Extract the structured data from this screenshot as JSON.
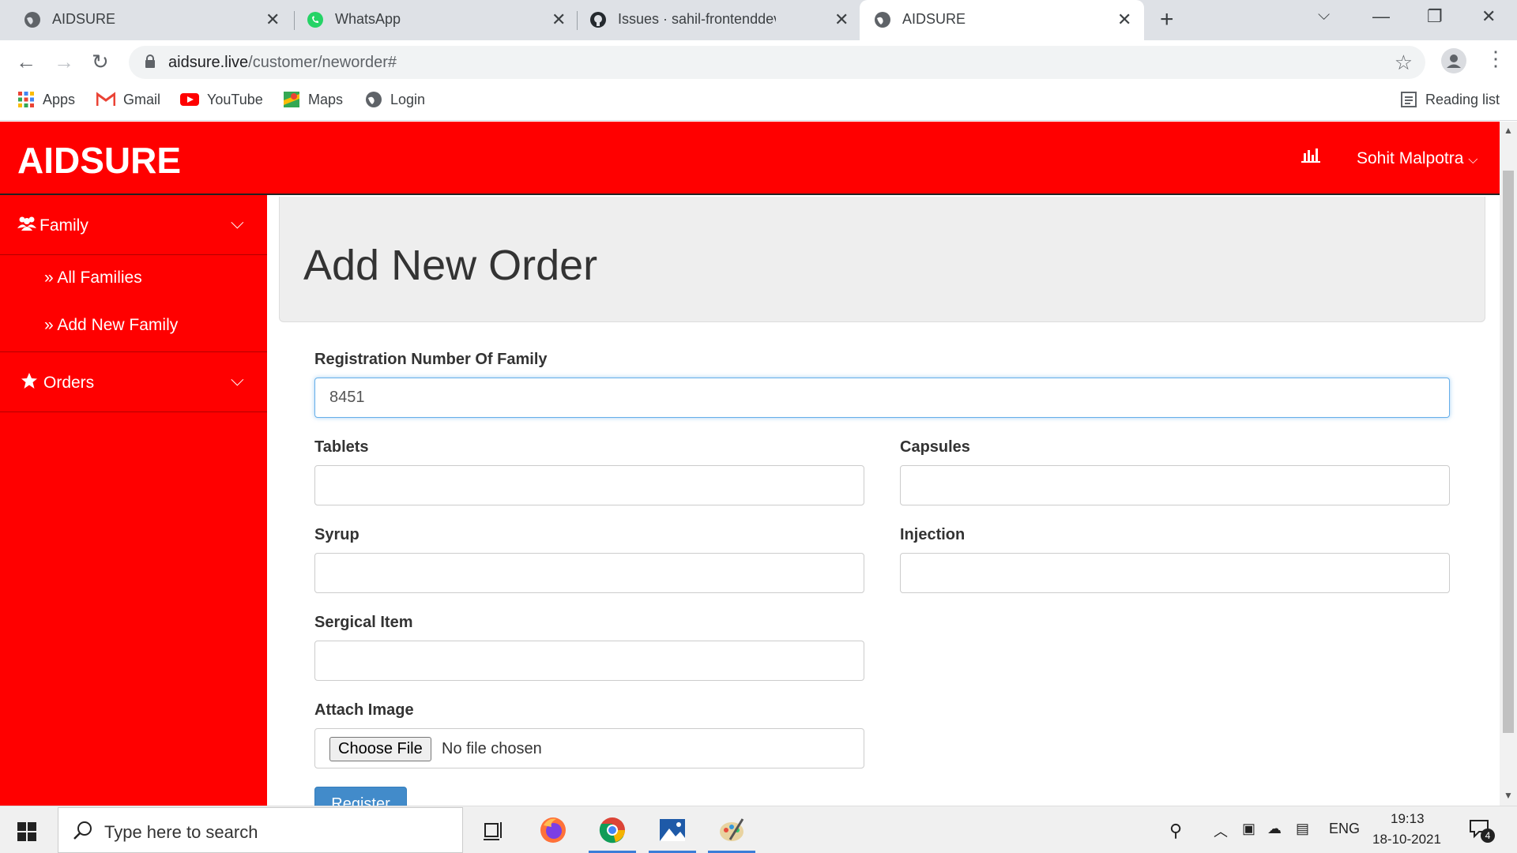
{
  "browser": {
    "tabs": [
      {
        "title": "AIDSURE",
        "icon": "globe-icon",
        "active": false
      },
      {
        "title": "WhatsApp",
        "icon": "whatsapp-icon",
        "active": false
      },
      {
        "title": "Issues · sahil-frontenddev/Aidsur",
        "icon": "github-icon",
        "active": false
      },
      {
        "title": "AIDSURE",
        "icon": "globe-icon",
        "active": true
      }
    ],
    "new_tab_glyph": "+",
    "close_glyph": "✕",
    "url_host": "aidsure.live",
    "url_path": "/customer/neworder#",
    "bookmarks": [
      {
        "label": "Apps",
        "icon": "apps-grid-icon"
      },
      {
        "label": "Gmail",
        "icon": "gmail-icon"
      },
      {
        "label": "YouTube",
        "icon": "youtube-icon"
      },
      {
        "label": "Maps",
        "icon": "maps-icon"
      },
      {
        "label": "Login",
        "icon": "globe-icon"
      }
    ],
    "reading_list": "Reading list"
  },
  "app": {
    "brand": "AIDSURE",
    "user_name": "Sohit Malpotra",
    "accent_color": "#ff0000"
  },
  "sidebar": {
    "family_label": "Family",
    "family_items": [
      "All Families",
      "Add New Family"
    ],
    "orders_label": "Orders"
  },
  "main": {
    "title": "Add New Order",
    "fields": {
      "registration_label": "Registration Number Of Family",
      "registration_value": "8451",
      "tablets_label": "Tablets",
      "capsules_label": "Capsules",
      "syrup_label": "Syrup",
      "injection_label": "Injection",
      "sergical_label": "Sergical Item",
      "attach_label": "Attach Image",
      "choose_file_label": "Choose File",
      "no_file_text": "No file chosen"
    },
    "register_label": "Register"
  },
  "taskbar": {
    "search_placeholder": "Type here to search",
    "language": "ENG",
    "time": "19:13",
    "date": "18-10-2021",
    "notification_count": "4"
  }
}
